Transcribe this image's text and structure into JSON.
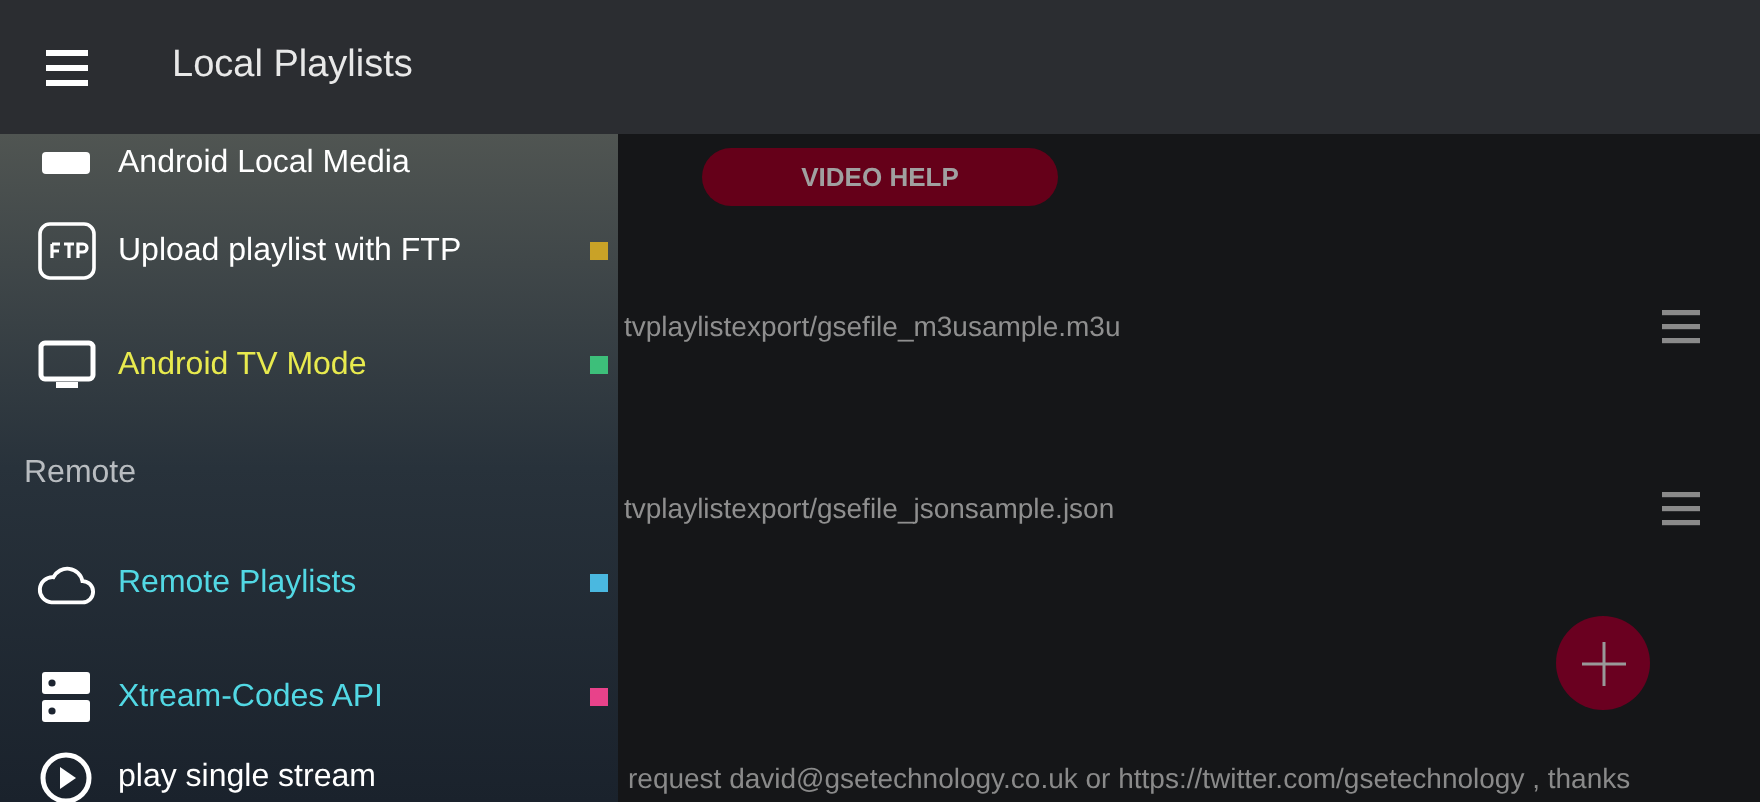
{
  "app_bar": {
    "title": "Local Playlists"
  },
  "main": {
    "video_help_button": "VIDEO HELP",
    "playlists": [
      {
        "path": "tvplaylistexport/gsefile_m3usample.m3u"
      },
      {
        "path": "tvplaylistexport/gsefile_jsonsample.json"
      }
    ],
    "footer": "request david@gsetechnology.co.uk or https://twitter.com/gsetechnology , thanks"
  },
  "drawer": {
    "items": [
      {
        "kind": "plain",
        "label": "Android Local Media"
      },
      {
        "kind": "plain",
        "label": "Upload playlist with FTP",
        "color": "#c9a227"
      },
      {
        "kind": "active",
        "label": "Android TV Mode",
        "color": "#3dbf7a"
      },
      {
        "kind": "header",
        "label": "Remote"
      },
      {
        "kind": "accent",
        "label": "Remote Playlists",
        "color": "#4ab8e0"
      },
      {
        "kind": "accent",
        "label": "Xtream-Codes API",
        "color": "#e8428a"
      },
      {
        "kind": "plain",
        "label": "play single stream"
      }
    ]
  }
}
